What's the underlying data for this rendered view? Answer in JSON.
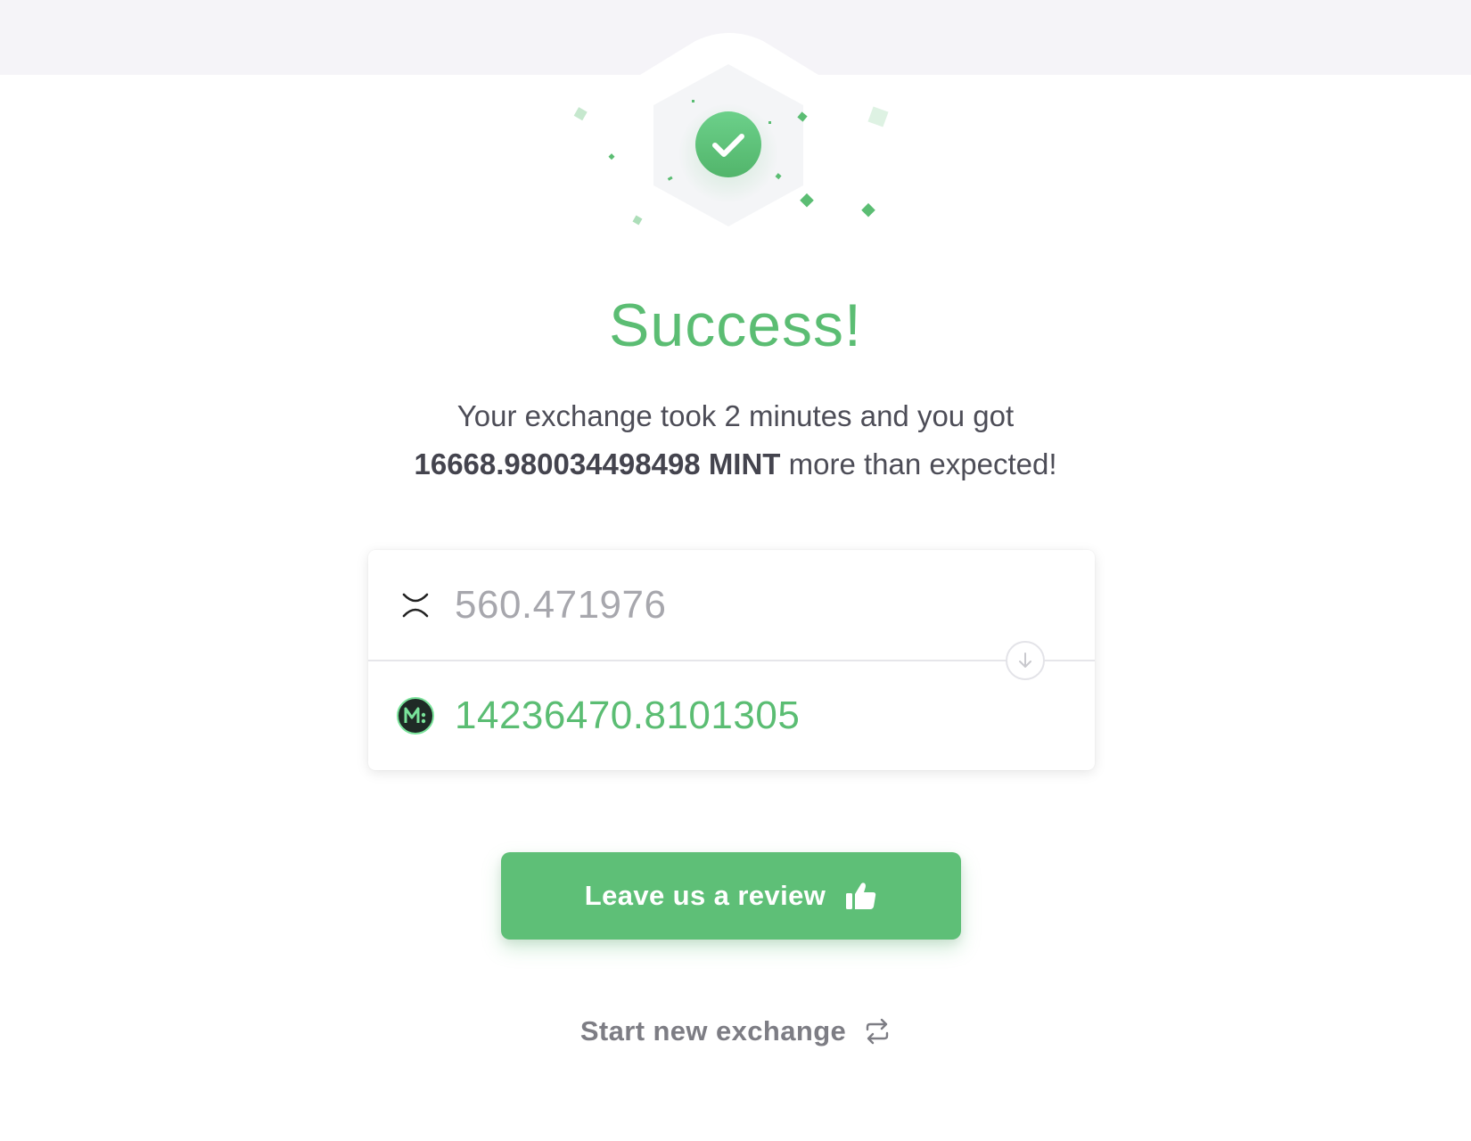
{
  "result": {
    "title": "Success!",
    "message_line1": "Your exchange took 2 minutes and you got",
    "bonus_amount": "16668.980034498498 MINT",
    "message_suffix": "more than expected!"
  },
  "exchange": {
    "from": {
      "amount": "560.471976",
      "icon": "xrp-icon"
    },
    "to": {
      "amount": "14236470.8101305",
      "icon": "mint-icon"
    },
    "direction_icon": "arrow-down-icon"
  },
  "actions": {
    "review_label": "Leave us a review",
    "review_icon": "thumbs-up-icon",
    "new_exchange_label": "Start new exchange",
    "new_exchange_icon": "swap-icon"
  },
  "colors": {
    "accent": "#5bbd73",
    "text": "#4d4d57",
    "muted": "#a7a7ad",
    "band": "#f5f4f8"
  }
}
